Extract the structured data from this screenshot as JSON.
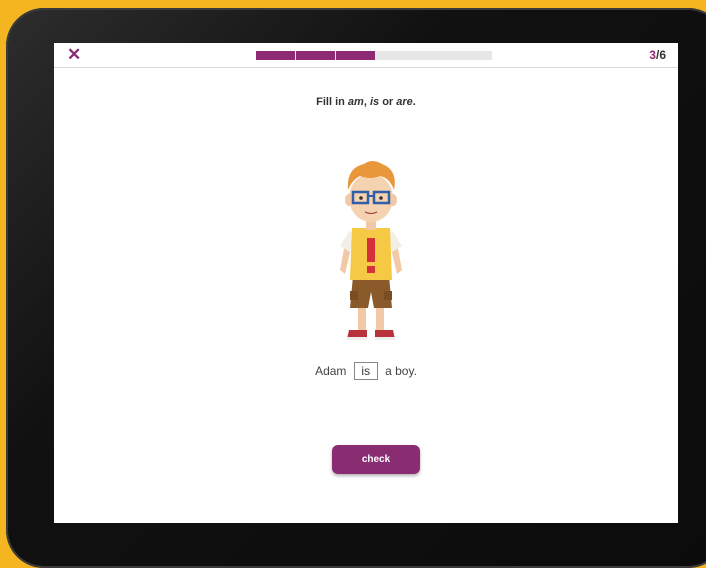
{
  "header": {
    "close_icon": "close-icon",
    "progress_segments_total": 6,
    "progress_segments_done": 3,
    "counter_current": "3",
    "counter_separator": "/",
    "counter_total": "6"
  },
  "exercise": {
    "instruction_prefix": "Fill in",
    "opt_am": "am",
    "comma": ",",
    "opt_is": "is",
    "or_word": "or",
    "opt_are": "are",
    "period": ".",
    "sentence_before": "Adam",
    "answer_value": "is",
    "sentence_after": "a boy."
  },
  "actions": {
    "check_label": "check"
  },
  "colors": {
    "accent": "#8e2a73",
    "frame": "#f4b521"
  }
}
